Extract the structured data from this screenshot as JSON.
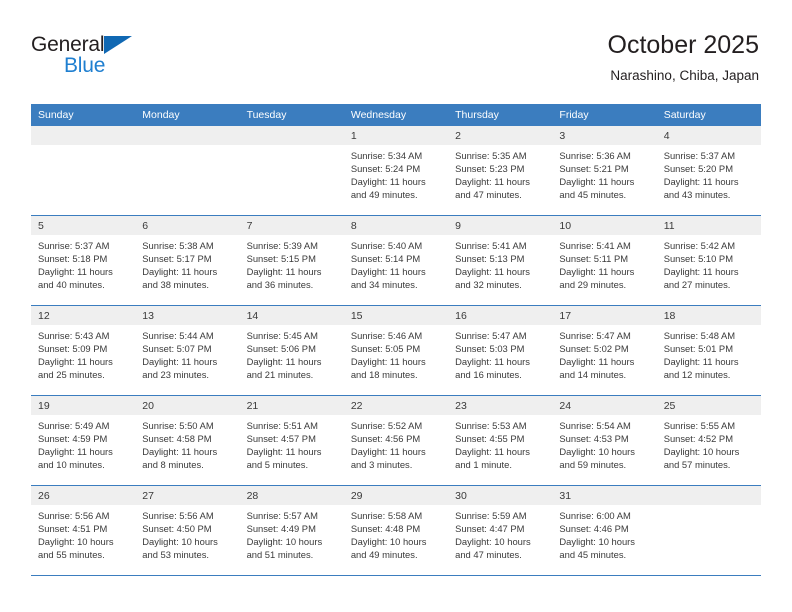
{
  "brand": {
    "name_top": "General",
    "name_bottom": "Blue",
    "triangle_color": "#1068b3",
    "text_color_top": "#231f20",
    "text_color_bottom": "#1f7fd0"
  },
  "header": {
    "title": "October 2025",
    "subtitle": "Narashino, Chiba, Japan"
  },
  "theme": {
    "header_blue": "#3b7dbf",
    "band_gray": "#efefef",
    "text_dark": "#3a3a3a"
  },
  "weekday_headers": [
    "Sunday",
    "Monday",
    "Tuesday",
    "Wednesday",
    "Thursday",
    "Friday",
    "Saturday"
  ],
  "weeks": [
    [
      {
        "day": "",
        "sunrise": "",
        "sunset": "",
        "daylight_line1": "",
        "daylight_line2": ""
      },
      {
        "day": "",
        "sunrise": "",
        "sunset": "",
        "daylight_line1": "",
        "daylight_line2": ""
      },
      {
        "day": "",
        "sunrise": "",
        "sunset": "",
        "daylight_line1": "",
        "daylight_line2": ""
      },
      {
        "day": "1",
        "sunrise": "Sunrise: 5:34 AM",
        "sunset": "Sunset: 5:24 PM",
        "daylight_line1": "Daylight: 11 hours",
        "daylight_line2": "and 49 minutes."
      },
      {
        "day": "2",
        "sunrise": "Sunrise: 5:35 AM",
        "sunset": "Sunset: 5:23 PM",
        "daylight_line1": "Daylight: 11 hours",
        "daylight_line2": "and 47 minutes."
      },
      {
        "day": "3",
        "sunrise": "Sunrise: 5:36 AM",
        "sunset": "Sunset: 5:21 PM",
        "daylight_line1": "Daylight: 11 hours",
        "daylight_line2": "and 45 minutes."
      },
      {
        "day": "4",
        "sunrise": "Sunrise: 5:37 AM",
        "sunset": "Sunset: 5:20 PM",
        "daylight_line1": "Daylight: 11 hours",
        "daylight_line2": "and 43 minutes."
      }
    ],
    [
      {
        "day": "5",
        "sunrise": "Sunrise: 5:37 AM",
        "sunset": "Sunset: 5:18 PM",
        "daylight_line1": "Daylight: 11 hours",
        "daylight_line2": "and 40 minutes."
      },
      {
        "day": "6",
        "sunrise": "Sunrise: 5:38 AM",
        "sunset": "Sunset: 5:17 PM",
        "daylight_line1": "Daylight: 11 hours",
        "daylight_line2": "and 38 minutes."
      },
      {
        "day": "7",
        "sunrise": "Sunrise: 5:39 AM",
        "sunset": "Sunset: 5:15 PM",
        "daylight_line1": "Daylight: 11 hours",
        "daylight_line2": "and 36 minutes."
      },
      {
        "day": "8",
        "sunrise": "Sunrise: 5:40 AM",
        "sunset": "Sunset: 5:14 PM",
        "daylight_line1": "Daylight: 11 hours",
        "daylight_line2": "and 34 minutes."
      },
      {
        "day": "9",
        "sunrise": "Sunrise: 5:41 AM",
        "sunset": "Sunset: 5:13 PM",
        "daylight_line1": "Daylight: 11 hours",
        "daylight_line2": "and 32 minutes."
      },
      {
        "day": "10",
        "sunrise": "Sunrise: 5:41 AM",
        "sunset": "Sunset: 5:11 PM",
        "daylight_line1": "Daylight: 11 hours",
        "daylight_line2": "and 29 minutes."
      },
      {
        "day": "11",
        "sunrise": "Sunrise: 5:42 AM",
        "sunset": "Sunset: 5:10 PM",
        "daylight_line1": "Daylight: 11 hours",
        "daylight_line2": "and 27 minutes."
      }
    ],
    [
      {
        "day": "12",
        "sunrise": "Sunrise: 5:43 AM",
        "sunset": "Sunset: 5:09 PM",
        "daylight_line1": "Daylight: 11 hours",
        "daylight_line2": "and 25 minutes."
      },
      {
        "day": "13",
        "sunrise": "Sunrise: 5:44 AM",
        "sunset": "Sunset: 5:07 PM",
        "daylight_line1": "Daylight: 11 hours",
        "daylight_line2": "and 23 minutes."
      },
      {
        "day": "14",
        "sunrise": "Sunrise: 5:45 AM",
        "sunset": "Sunset: 5:06 PM",
        "daylight_line1": "Daylight: 11 hours",
        "daylight_line2": "and 21 minutes."
      },
      {
        "day": "15",
        "sunrise": "Sunrise: 5:46 AM",
        "sunset": "Sunset: 5:05 PM",
        "daylight_line1": "Daylight: 11 hours",
        "daylight_line2": "and 18 minutes."
      },
      {
        "day": "16",
        "sunrise": "Sunrise: 5:47 AM",
        "sunset": "Sunset: 5:03 PM",
        "daylight_line1": "Daylight: 11 hours",
        "daylight_line2": "and 16 minutes."
      },
      {
        "day": "17",
        "sunrise": "Sunrise: 5:47 AM",
        "sunset": "Sunset: 5:02 PM",
        "daylight_line1": "Daylight: 11 hours",
        "daylight_line2": "and 14 minutes."
      },
      {
        "day": "18",
        "sunrise": "Sunrise: 5:48 AM",
        "sunset": "Sunset: 5:01 PM",
        "daylight_line1": "Daylight: 11 hours",
        "daylight_line2": "and 12 minutes."
      }
    ],
    [
      {
        "day": "19",
        "sunrise": "Sunrise: 5:49 AM",
        "sunset": "Sunset: 4:59 PM",
        "daylight_line1": "Daylight: 11 hours",
        "daylight_line2": "and 10 minutes."
      },
      {
        "day": "20",
        "sunrise": "Sunrise: 5:50 AM",
        "sunset": "Sunset: 4:58 PM",
        "daylight_line1": "Daylight: 11 hours",
        "daylight_line2": "and 8 minutes."
      },
      {
        "day": "21",
        "sunrise": "Sunrise: 5:51 AM",
        "sunset": "Sunset: 4:57 PM",
        "daylight_line1": "Daylight: 11 hours",
        "daylight_line2": "and 5 minutes."
      },
      {
        "day": "22",
        "sunrise": "Sunrise: 5:52 AM",
        "sunset": "Sunset: 4:56 PM",
        "daylight_line1": "Daylight: 11 hours",
        "daylight_line2": "and 3 minutes."
      },
      {
        "day": "23",
        "sunrise": "Sunrise: 5:53 AM",
        "sunset": "Sunset: 4:55 PM",
        "daylight_line1": "Daylight: 11 hours",
        "daylight_line2": "and 1 minute."
      },
      {
        "day": "24",
        "sunrise": "Sunrise: 5:54 AM",
        "sunset": "Sunset: 4:53 PM",
        "daylight_line1": "Daylight: 10 hours",
        "daylight_line2": "and 59 minutes."
      },
      {
        "day": "25",
        "sunrise": "Sunrise: 5:55 AM",
        "sunset": "Sunset: 4:52 PM",
        "daylight_line1": "Daylight: 10 hours",
        "daylight_line2": "and 57 minutes."
      }
    ],
    [
      {
        "day": "26",
        "sunrise": "Sunrise: 5:56 AM",
        "sunset": "Sunset: 4:51 PM",
        "daylight_line1": "Daylight: 10 hours",
        "daylight_line2": "and 55 minutes."
      },
      {
        "day": "27",
        "sunrise": "Sunrise: 5:56 AM",
        "sunset": "Sunset: 4:50 PM",
        "daylight_line1": "Daylight: 10 hours",
        "daylight_line2": "and 53 minutes."
      },
      {
        "day": "28",
        "sunrise": "Sunrise: 5:57 AM",
        "sunset": "Sunset: 4:49 PM",
        "daylight_line1": "Daylight: 10 hours",
        "daylight_line2": "and 51 minutes."
      },
      {
        "day": "29",
        "sunrise": "Sunrise: 5:58 AM",
        "sunset": "Sunset: 4:48 PM",
        "daylight_line1": "Daylight: 10 hours",
        "daylight_line2": "and 49 minutes."
      },
      {
        "day": "30",
        "sunrise": "Sunrise: 5:59 AM",
        "sunset": "Sunset: 4:47 PM",
        "daylight_line1": "Daylight: 10 hours",
        "daylight_line2": "and 47 minutes."
      },
      {
        "day": "31",
        "sunrise": "Sunrise: 6:00 AM",
        "sunset": "Sunset: 4:46 PM",
        "daylight_line1": "Daylight: 10 hours",
        "daylight_line2": "and 45 minutes."
      },
      {
        "day": "",
        "sunrise": "",
        "sunset": "",
        "daylight_line1": "",
        "daylight_line2": ""
      }
    ]
  ]
}
